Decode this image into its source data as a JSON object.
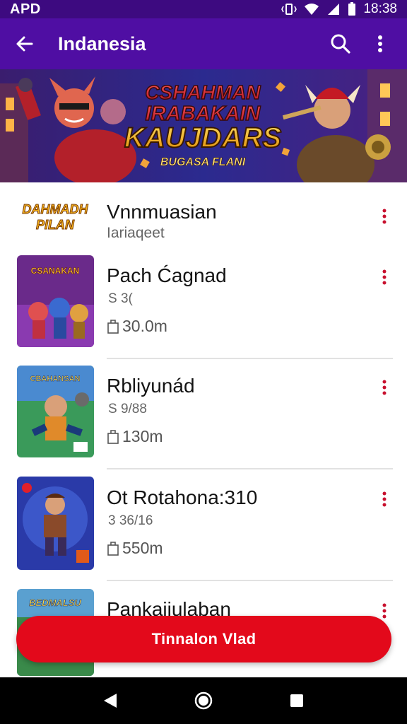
{
  "status_bar": {
    "left": "APD",
    "time": "18:38"
  },
  "app_bar": {
    "title": "Indanesia",
    "back_icon": "arrow-left-icon",
    "search_icon": "search-icon",
    "menu_icon": "more-vertical-icon"
  },
  "banner": {
    "line1": "CSHAHMAN",
    "line2": "IRABAKAIN",
    "line3": "KAUJDARS",
    "line4": "BUGASA FLANI"
  },
  "featured": {
    "logo_line1": "DAHMADH",
    "logo_line2": "PILAN",
    "title": "Vnnmuasian",
    "subtitle": "Iariaqeet"
  },
  "apps": [
    {
      "title": "Pach Ćagnad",
      "subtitle": "S 3(",
      "size": "30.0m",
      "thumb_text": "CSANAKAN"
    },
    {
      "title": "Rbliyunád",
      "subtitle": "S 9/88",
      "size": "130m",
      "thumb_text": "CBAHANSAN"
    },
    {
      "title": "Ot Rotahona:310",
      "subtitle": "3 36/16",
      "size": "550m",
      "thumb_text": ""
    },
    {
      "title": "Pankajiulaban",
      "subtitle": "",
      "size": "",
      "thumb_text": "BEDMALSU"
    }
  ],
  "cta": {
    "label": "Tinnalon Vlad"
  },
  "colors": {
    "primary": "#4f0ea3",
    "status": "#3d0a80",
    "accent": "#e3091b"
  }
}
